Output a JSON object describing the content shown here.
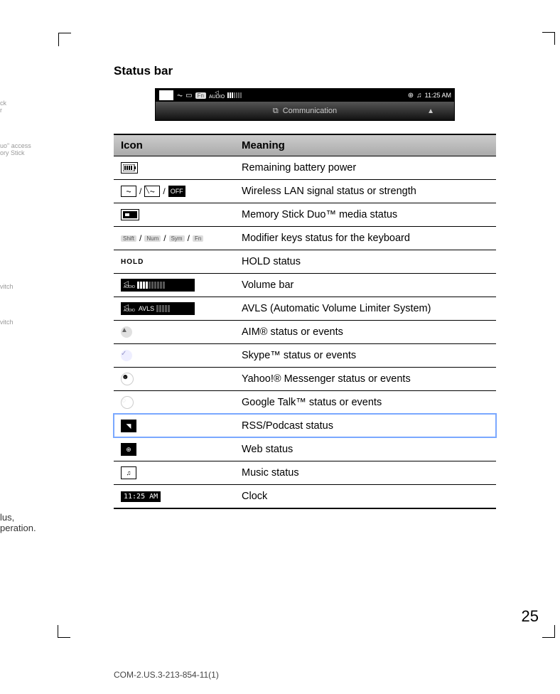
{
  "section_title": "Status bar",
  "statusbar": {
    "audio_label": "AUDIO",
    "time": "11:25 AM",
    "bottom_label": "Communication"
  },
  "table": {
    "head_icon": "Icon",
    "head_meaning": "Meaning",
    "rows": [
      {
        "icon_text": "",
        "meaning": "Remaining battery power"
      },
      {
        "icon_text": "",
        "meaning": "Wireless LAN signal status or strength"
      },
      {
        "icon_text": "",
        "meaning": "Memory Stick Duo™ media status"
      },
      {
        "icon_text": "",
        "meaning": "Modifier keys status for the keyboard"
      },
      {
        "icon_text": "HOLD",
        "meaning": "HOLD status"
      },
      {
        "icon_text": "",
        "meaning": "Volume bar"
      },
      {
        "icon_text": "AVLS",
        "meaning": "AVLS (Automatic Volume Limiter System)"
      },
      {
        "icon_text": "",
        "meaning": "AIM® status or events"
      },
      {
        "icon_text": "",
        "meaning": "Skype™ status or events"
      },
      {
        "icon_text": "",
        "meaning": "Yahoo!® Messenger status or events"
      },
      {
        "icon_text": "",
        "meaning": "Google Talk™ status or events"
      },
      {
        "icon_text": "",
        "meaning": "RSS/Podcast status"
      },
      {
        "icon_text": "",
        "meaning": "Web status"
      },
      {
        "icon_text": "",
        "meaning": "Music status"
      },
      {
        "icon_text": "11:25 AM",
        "meaning": "Clock"
      }
    ]
  },
  "modifier_keys": [
    "Shift",
    "Num",
    "Sym",
    "Fn"
  ],
  "margin": {
    "l1": "ck",
    "l2": "r",
    "l3": "uo\" access",
    "l4": "ory Stick",
    "l5": "vitch",
    "l6": "vitch",
    "l7": "lus,",
    "l8": "peration."
  },
  "page_number": "25",
  "footer_code": "COM-2.US.3-213-854-11(1)"
}
